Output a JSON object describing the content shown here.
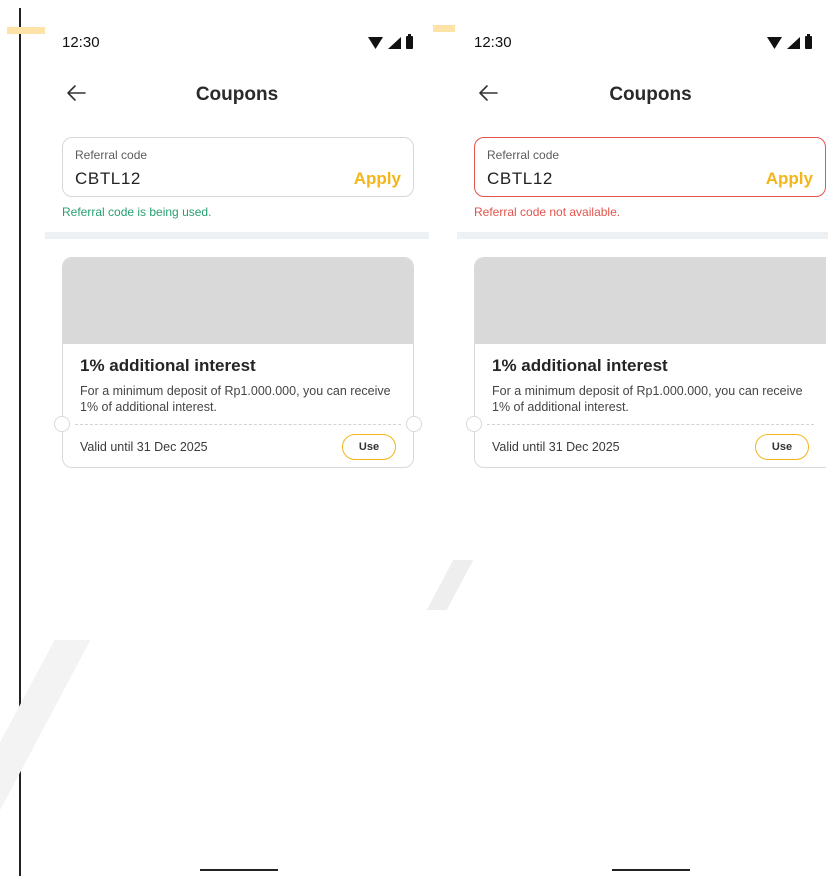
{
  "screens": [
    {
      "status_time": "12:30",
      "title": "Coupons",
      "referral": {
        "label": "Referral code",
        "value": "CBTL12",
        "apply_label": "Apply"
      },
      "message": "Referral code is being used.",
      "message_status": "success",
      "coupon": {
        "title": "1% additional interest",
        "description": "For a minimum deposit of Rp1.000.000, you can receive 1% of additional interest.",
        "valid_until": "Valid until 31 Dec 2025",
        "use_label": "Use"
      }
    },
    {
      "status_time": "12:30",
      "title": "Coupons",
      "referral": {
        "label": "Referral code",
        "value": "CBTL12",
        "apply_label": "Apply"
      },
      "message": "Referral code not available.",
      "message_status": "error",
      "coupon": {
        "title": "1% additional interest",
        "description": "For a minimum deposit of Rp1.000.000, you can receive 1% of additional interest.",
        "valid_until": "Valid until 31 Dec 2025",
        "use_label": "Use"
      }
    }
  ],
  "icons": {
    "back": "arrow-left-icon",
    "wifi": "wifi-icon",
    "signal": "signal-icon",
    "battery": "battery-icon"
  },
  "colors": {
    "accent": "#f4b51a",
    "success": "#27a06f",
    "error": "#e4534d",
    "divider": "#eef1f4",
    "placeholder_banner": "#d9d9d9"
  }
}
